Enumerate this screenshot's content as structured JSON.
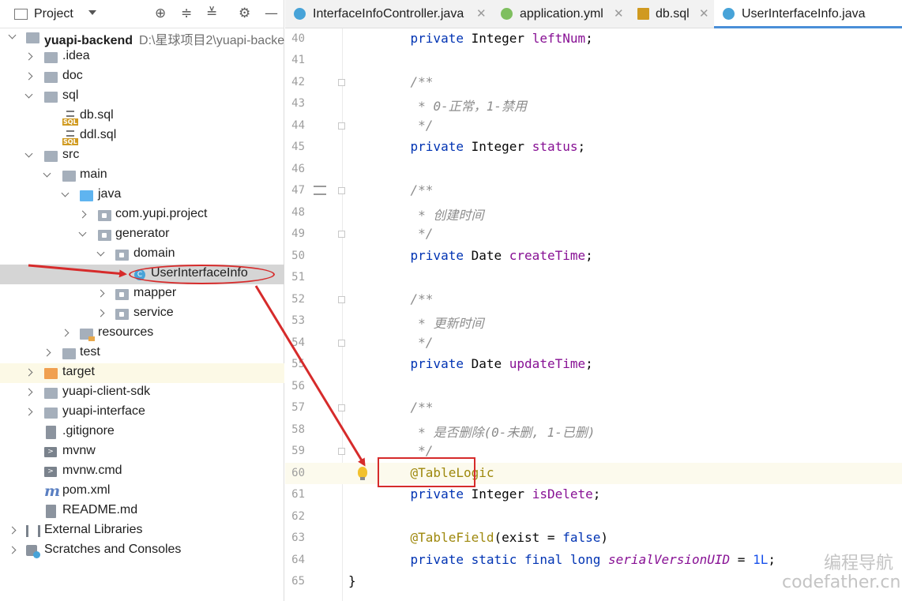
{
  "project_panel": {
    "title": "Project",
    "root_name": "yuapi-backend",
    "root_path": "D:\\星球项目2\\yuapi-backe",
    "nodes": [
      {
        "label": "yuapi-backend"
      },
      {
        "label": ".idea"
      },
      {
        "label": "doc"
      },
      {
        "label": "sql"
      },
      {
        "label": "db.sql"
      },
      {
        "label": "ddl.sql"
      },
      {
        "label": "src"
      },
      {
        "label": "main"
      },
      {
        "label": "java"
      },
      {
        "label": "com.yupi.project"
      },
      {
        "label": "generator"
      },
      {
        "label": "domain"
      },
      {
        "label": "UserInterfaceInfo"
      },
      {
        "label": "mapper"
      },
      {
        "label": "service"
      },
      {
        "label": "resources"
      },
      {
        "label": "test"
      },
      {
        "label": "target"
      },
      {
        "label": "yuapi-client-sdk"
      },
      {
        "label": "yuapi-interface"
      },
      {
        "label": ".gitignore"
      },
      {
        "label": "mvnw"
      },
      {
        "label": "mvnw.cmd"
      },
      {
        "label": "pom.xml"
      },
      {
        "label": "README.md"
      },
      {
        "label": "External Libraries"
      },
      {
        "label": "Scratches and Consoles"
      }
    ]
  },
  "tabs": [
    {
      "label": "InterfaceInfoController.java",
      "icon": "java-class-icon"
    },
    {
      "label": "application.yml",
      "icon": "yaml-icon"
    },
    {
      "label": "db.sql",
      "icon": "sql-icon"
    },
    {
      "label": "UserInterfaceInfo.java",
      "icon": "java-class-icon",
      "active": true
    }
  ],
  "editor": {
    "line_numbers": [
      "40",
      "41",
      "42",
      "43",
      "44",
      "45",
      "46",
      "47",
      "48",
      "49",
      "50",
      "51",
      "52",
      "53",
      "54",
      "55",
      "56",
      "57",
      "58",
      "59",
      "60",
      "61",
      "62",
      "63",
      "64",
      "65"
    ],
    "lines": {
      "l40": {
        "kw": "private",
        "type": "Integer",
        "name": "leftNum",
        "end": ";"
      },
      "l42": "/**",
      "l43": "* 0-正常，1-禁用",
      "l44": "*/",
      "l45": {
        "kw": "private",
        "type": "Integer",
        "name": "status",
        "end": ";"
      },
      "l47": "/**",
      "l48": "* 创建时间",
      "l49": "*/",
      "l50": {
        "kw": "private",
        "type": "Date",
        "name": "createTime",
        "end": ";"
      },
      "l52": "/**",
      "l53": "* 更新时间",
      "l54": "*/",
      "l55": {
        "kw": "private",
        "type": "Date",
        "name": "updateTime",
        "end": ";"
      },
      "l57": "/**",
      "l58": "* 是否删除(0-未删, 1-已删)",
      "l59": "*/",
      "l60": "@TableLogic",
      "l61": {
        "kw": "private",
        "type": "Integer",
        "name": "isDelete",
        "end": ";"
      },
      "l63": {
        "ann": "@TableField",
        "open": "(exist = ",
        "val": "false",
        "close": ")"
      },
      "l64": {
        "kw1": "private",
        "kw2": "static",
        "kw3": "final",
        "kw4": "long",
        "name": "serialVersionUID",
        "eq": " = ",
        "num": "1L",
        "end": ";"
      },
      "l65": "}"
    }
  },
  "watermark": {
    "line1": "编程导航",
    "line2": "codefather.cn"
  },
  "colors": {
    "annotation_red": "#d62b2b",
    "tab_underline": "#4a8fd8",
    "keyword": "#0033b3",
    "field": "#871094"
  }
}
